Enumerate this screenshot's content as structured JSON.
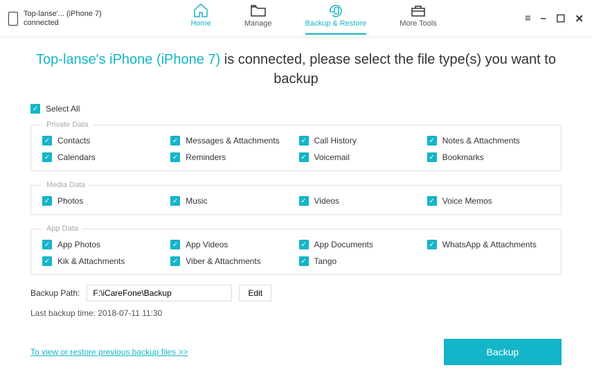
{
  "device": {
    "name": "Top-lanse'... (iPhone 7)",
    "status": "connected"
  },
  "nav": {
    "home": "Home",
    "manage": "Manage",
    "backup_restore": "Backup & Restore",
    "more_tools": "More Tools"
  },
  "title": {
    "device_name": "Top-lanse's iPhone (iPhone 7)",
    "rest": " is connected, please select the file type(s) you want to backup"
  },
  "select_all": "Select All",
  "groups": {
    "private": {
      "legend": "Private Data",
      "items": [
        "Contacts",
        "Messages & Attachments",
        "Call History",
        "Notes & Attachments",
        "Calendars",
        "Reminders",
        "Voicemail",
        "Bookmarks"
      ]
    },
    "media": {
      "legend": "Media Data",
      "items": [
        "Photos",
        "Music",
        "Videos",
        "Voice Memos"
      ]
    },
    "app": {
      "legend": "App Data",
      "items": [
        "App Photos",
        "App Videos",
        "App Documents",
        "WhatsApp & Attachments",
        "Kik & Attachments",
        "Viber & Attachments",
        "Tango"
      ]
    }
  },
  "path": {
    "label": "Backup Path:",
    "value": "F:\\iCareFone\\Backup",
    "edit": "Edit"
  },
  "last_backup": "Last backup time: 2018-07-11 11:30",
  "link": "To view or restore previous backup files >>",
  "backup_btn": "Backup"
}
